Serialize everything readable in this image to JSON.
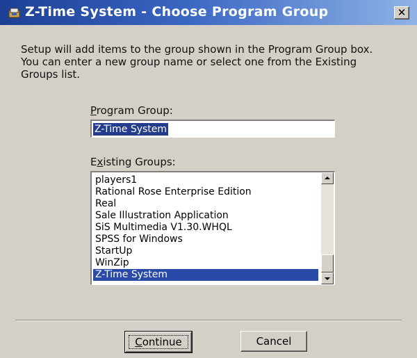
{
  "window": {
    "title": "Z-Time System - Choose Program Group",
    "close_label": "✕",
    "icon": "setup-app-icon"
  },
  "description": {
    "lines": [
      "Setup will add items to the group shown in the Program Group box.",
      "You can enter a new group name or select one from the Existing",
      "Groups list."
    ]
  },
  "program_group": {
    "label_prefix": "",
    "label_mnemonic": "P",
    "label_rest": "rogram Group:",
    "value": "Z-Time System"
  },
  "existing_groups": {
    "label_prefix": "E",
    "label_mnemonic": "x",
    "label_rest": "isting Groups:",
    "items": [
      "players1",
      "Rational Rose Enterprise Edition",
      "Real",
      "Sale Illustration Application",
      "SiS Multimedia V1.30.WHQL",
      "SPSS for Windows",
      "StartUp",
      "WinZip",
      "Z-Time System"
    ],
    "selected": "Z-Time System"
  },
  "buttons": {
    "continue_mnemonic": "C",
    "continue_rest": "ontinue",
    "cancel_label": "Cancel"
  }
}
